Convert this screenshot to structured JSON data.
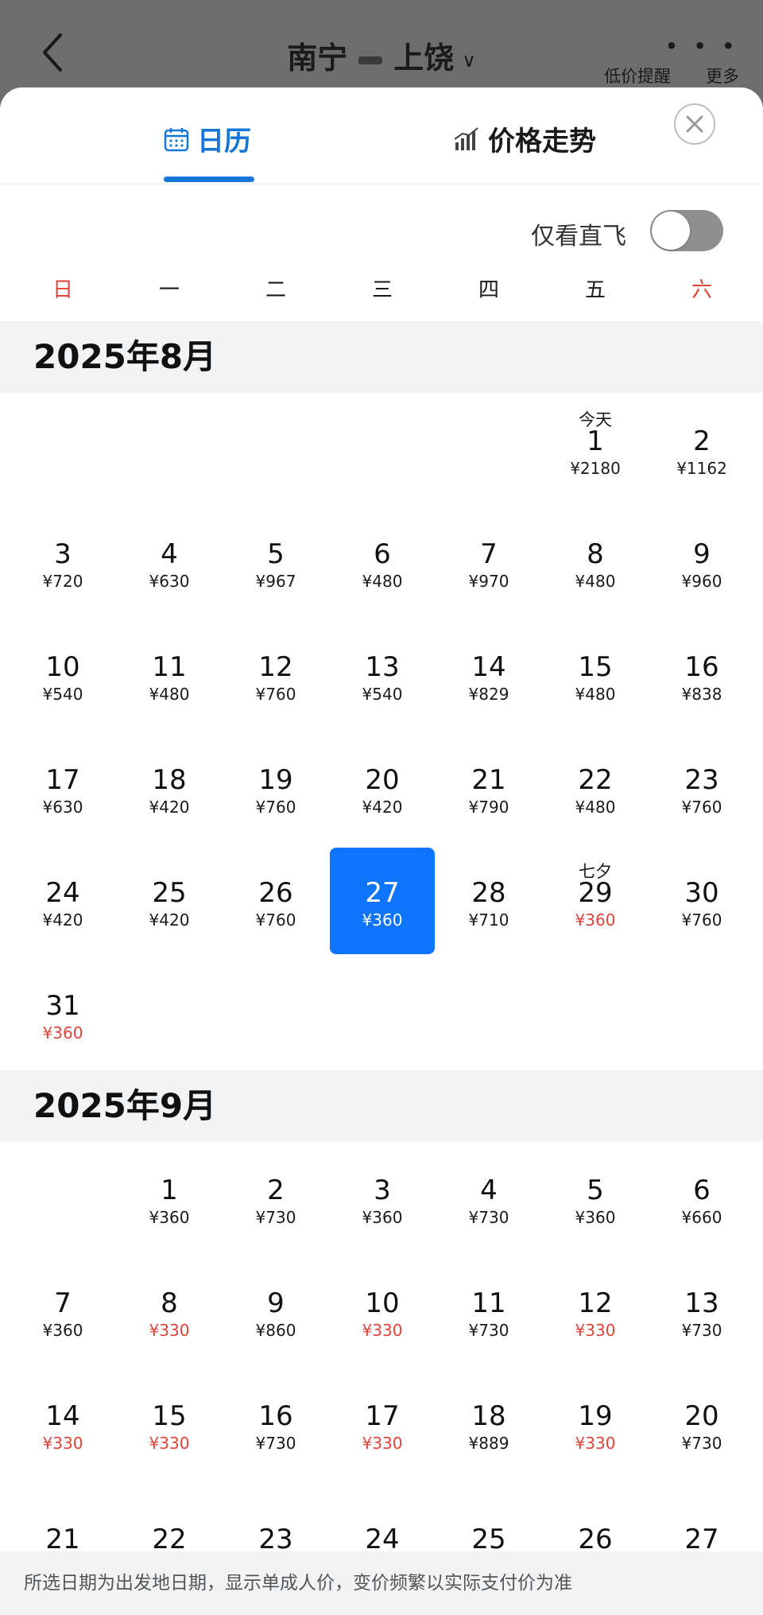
{
  "header": {
    "origin": "南宁",
    "destination": "上饶",
    "price_alert": "低价提醒",
    "more": "更多",
    "more_dots": "• • •"
  },
  "tabs": {
    "calendar": "日历",
    "trend": "价格走势"
  },
  "filter": {
    "direct_only": "仅看直飞",
    "direct_enabled": false
  },
  "weekdays": [
    "日",
    "一",
    "二",
    "三",
    "四",
    "五",
    "六"
  ],
  "months": [
    {
      "title": "2025年8月",
      "leading_blanks": 5,
      "days": [
        {
          "day": "1",
          "price": "¥2180",
          "note": "今天"
        },
        {
          "day": "2",
          "price": "¥1162"
        },
        {
          "day": "3",
          "price": "¥720"
        },
        {
          "day": "4",
          "price": "¥630"
        },
        {
          "day": "5",
          "price": "¥967"
        },
        {
          "day": "6",
          "price": "¥480"
        },
        {
          "day": "7",
          "price": "¥970"
        },
        {
          "day": "8",
          "price": "¥480"
        },
        {
          "day": "9",
          "price": "¥960"
        },
        {
          "day": "10",
          "price": "¥540"
        },
        {
          "day": "11",
          "price": "¥480"
        },
        {
          "day": "12",
          "price": "¥760"
        },
        {
          "day": "13",
          "price": "¥540"
        },
        {
          "day": "14",
          "price": "¥829"
        },
        {
          "day": "15",
          "price": "¥480"
        },
        {
          "day": "16",
          "price": "¥838"
        },
        {
          "day": "17",
          "price": "¥630"
        },
        {
          "day": "18",
          "price": "¥420"
        },
        {
          "day": "19",
          "price": "¥760"
        },
        {
          "day": "20",
          "price": "¥420"
        },
        {
          "day": "21",
          "price": "¥790"
        },
        {
          "day": "22",
          "price": "¥480"
        },
        {
          "day": "23",
          "price": "¥760"
        },
        {
          "day": "24",
          "price": "¥420"
        },
        {
          "day": "25",
          "price": "¥420"
        },
        {
          "day": "26",
          "price": "¥760"
        },
        {
          "day": "27",
          "price": "¥360",
          "selected": true
        },
        {
          "day": "28",
          "price": "¥710"
        },
        {
          "day": "29",
          "price": "¥360",
          "note": "七夕",
          "low": true
        },
        {
          "day": "30",
          "price": "¥760"
        },
        {
          "day": "31",
          "price": "¥360",
          "low": true
        }
      ]
    },
    {
      "title": "2025年9月",
      "leading_blanks": 1,
      "days": [
        {
          "day": "1",
          "price": "¥360"
        },
        {
          "day": "2",
          "price": "¥730"
        },
        {
          "day": "3",
          "price": "¥360"
        },
        {
          "day": "4",
          "price": "¥730"
        },
        {
          "day": "5",
          "price": "¥360"
        },
        {
          "day": "6",
          "price": "¥660"
        },
        {
          "day": "7",
          "price": "¥360"
        },
        {
          "day": "8",
          "price": "¥330",
          "low": true
        },
        {
          "day": "9",
          "price": "¥860"
        },
        {
          "day": "10",
          "price": "¥330",
          "low": true
        },
        {
          "day": "11",
          "price": "¥730"
        },
        {
          "day": "12",
          "price": "¥330",
          "low": true
        },
        {
          "day": "13",
          "price": "¥730"
        },
        {
          "day": "14",
          "price": "¥330",
          "low": true
        },
        {
          "day": "15",
          "price": "¥330",
          "low": true
        },
        {
          "day": "16",
          "price": "¥730"
        },
        {
          "day": "17",
          "price": "¥330",
          "low": true
        },
        {
          "day": "18",
          "price": "¥889"
        },
        {
          "day": "19",
          "price": "¥330",
          "low": true
        },
        {
          "day": "20",
          "price": "¥730"
        },
        {
          "day": "21",
          "price": ""
        },
        {
          "day": "22",
          "price": ""
        },
        {
          "day": "23",
          "price": ""
        },
        {
          "day": "24",
          "price": ""
        },
        {
          "day": "25",
          "price": ""
        },
        {
          "day": "26",
          "price": ""
        },
        {
          "day": "27",
          "price": ""
        }
      ]
    }
  ],
  "footer": {
    "note": "所选日期为出发地日期，显示单成人价，变价频繁以实际支付价为准"
  },
  "colors": {
    "accent": "#1677d8",
    "selected": "#0f74ff",
    "low_price": "#e0433a"
  }
}
